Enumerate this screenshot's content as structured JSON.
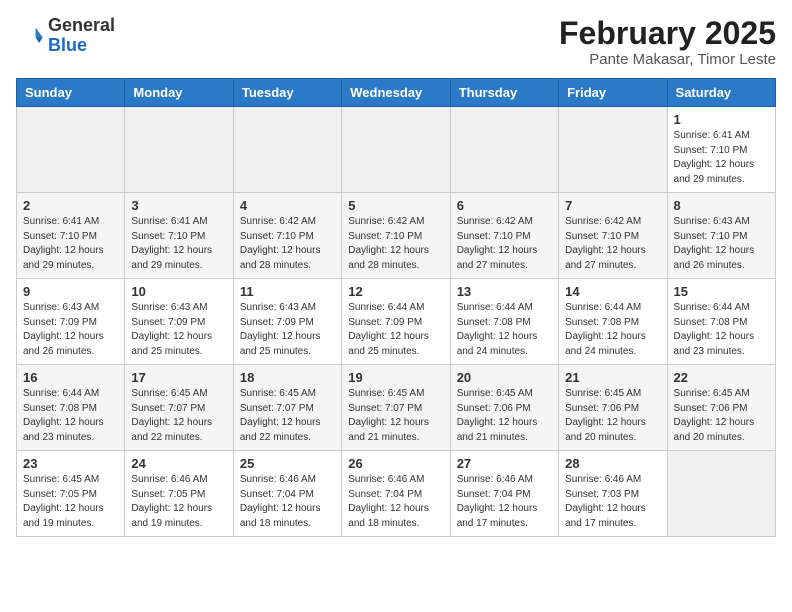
{
  "header": {
    "logo_general": "General",
    "logo_blue": "Blue",
    "month_year": "February 2025",
    "location": "Pante Makasar, Timor Leste"
  },
  "days_of_week": [
    "Sunday",
    "Monday",
    "Tuesday",
    "Wednesday",
    "Thursday",
    "Friday",
    "Saturday"
  ],
  "weeks": [
    [
      {
        "day": "",
        "info": ""
      },
      {
        "day": "",
        "info": ""
      },
      {
        "day": "",
        "info": ""
      },
      {
        "day": "",
        "info": ""
      },
      {
        "day": "",
        "info": ""
      },
      {
        "day": "",
        "info": ""
      },
      {
        "day": "1",
        "info": "Sunrise: 6:41 AM\nSunset: 7:10 PM\nDaylight: 12 hours and 29 minutes."
      }
    ],
    [
      {
        "day": "2",
        "info": "Sunrise: 6:41 AM\nSunset: 7:10 PM\nDaylight: 12 hours and 29 minutes."
      },
      {
        "day": "3",
        "info": "Sunrise: 6:41 AM\nSunset: 7:10 PM\nDaylight: 12 hours and 29 minutes."
      },
      {
        "day": "4",
        "info": "Sunrise: 6:42 AM\nSunset: 7:10 PM\nDaylight: 12 hours and 28 minutes."
      },
      {
        "day": "5",
        "info": "Sunrise: 6:42 AM\nSunset: 7:10 PM\nDaylight: 12 hours and 28 minutes."
      },
      {
        "day": "6",
        "info": "Sunrise: 6:42 AM\nSunset: 7:10 PM\nDaylight: 12 hours and 27 minutes."
      },
      {
        "day": "7",
        "info": "Sunrise: 6:42 AM\nSunset: 7:10 PM\nDaylight: 12 hours and 27 minutes."
      },
      {
        "day": "8",
        "info": "Sunrise: 6:43 AM\nSunset: 7:10 PM\nDaylight: 12 hours and 26 minutes."
      }
    ],
    [
      {
        "day": "9",
        "info": "Sunrise: 6:43 AM\nSunset: 7:09 PM\nDaylight: 12 hours and 26 minutes."
      },
      {
        "day": "10",
        "info": "Sunrise: 6:43 AM\nSunset: 7:09 PM\nDaylight: 12 hours and 25 minutes."
      },
      {
        "day": "11",
        "info": "Sunrise: 6:43 AM\nSunset: 7:09 PM\nDaylight: 12 hours and 25 minutes."
      },
      {
        "day": "12",
        "info": "Sunrise: 6:44 AM\nSunset: 7:09 PM\nDaylight: 12 hours and 25 minutes."
      },
      {
        "day": "13",
        "info": "Sunrise: 6:44 AM\nSunset: 7:08 PM\nDaylight: 12 hours and 24 minutes."
      },
      {
        "day": "14",
        "info": "Sunrise: 6:44 AM\nSunset: 7:08 PM\nDaylight: 12 hours and 24 minutes."
      },
      {
        "day": "15",
        "info": "Sunrise: 6:44 AM\nSunset: 7:08 PM\nDaylight: 12 hours and 23 minutes."
      }
    ],
    [
      {
        "day": "16",
        "info": "Sunrise: 6:44 AM\nSunset: 7:08 PM\nDaylight: 12 hours and 23 minutes."
      },
      {
        "day": "17",
        "info": "Sunrise: 6:45 AM\nSunset: 7:07 PM\nDaylight: 12 hours and 22 minutes."
      },
      {
        "day": "18",
        "info": "Sunrise: 6:45 AM\nSunset: 7:07 PM\nDaylight: 12 hours and 22 minutes."
      },
      {
        "day": "19",
        "info": "Sunrise: 6:45 AM\nSunset: 7:07 PM\nDaylight: 12 hours and 21 minutes."
      },
      {
        "day": "20",
        "info": "Sunrise: 6:45 AM\nSunset: 7:06 PM\nDaylight: 12 hours and 21 minutes."
      },
      {
        "day": "21",
        "info": "Sunrise: 6:45 AM\nSunset: 7:06 PM\nDaylight: 12 hours and 20 minutes."
      },
      {
        "day": "22",
        "info": "Sunrise: 6:45 AM\nSunset: 7:06 PM\nDaylight: 12 hours and 20 minutes."
      }
    ],
    [
      {
        "day": "23",
        "info": "Sunrise: 6:45 AM\nSunset: 7:05 PM\nDaylight: 12 hours and 19 minutes."
      },
      {
        "day": "24",
        "info": "Sunrise: 6:46 AM\nSunset: 7:05 PM\nDaylight: 12 hours and 19 minutes."
      },
      {
        "day": "25",
        "info": "Sunrise: 6:46 AM\nSunset: 7:04 PM\nDaylight: 12 hours and 18 minutes."
      },
      {
        "day": "26",
        "info": "Sunrise: 6:46 AM\nSunset: 7:04 PM\nDaylight: 12 hours and 18 minutes."
      },
      {
        "day": "27",
        "info": "Sunrise: 6:46 AM\nSunset: 7:04 PM\nDaylight: 12 hours and 17 minutes."
      },
      {
        "day": "28",
        "info": "Sunrise: 6:46 AM\nSunset: 7:03 PM\nDaylight: 12 hours and 17 minutes."
      },
      {
        "day": "",
        "info": ""
      }
    ]
  ]
}
